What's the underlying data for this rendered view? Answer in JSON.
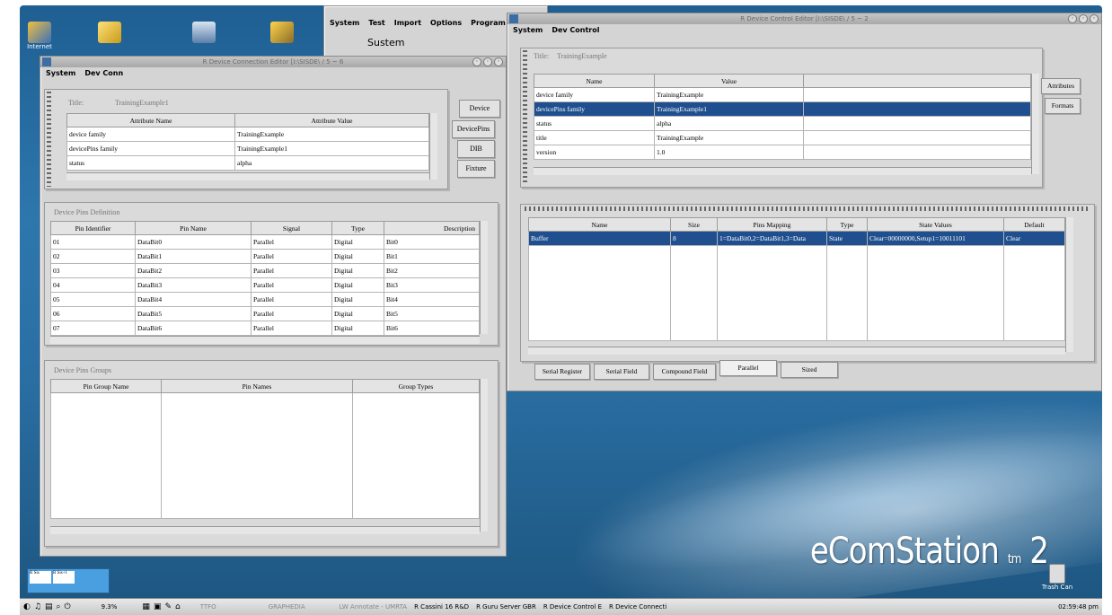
{
  "desktop": {
    "icons": [
      "Internet",
      "",
      "",
      ""
    ],
    "brand": "eComStation",
    "brand_tm": "tm",
    "brand_ver": "2",
    "trash_label": "Trash Can"
  },
  "back_window": {
    "menu": [
      "System",
      "Test",
      "Import",
      "Options",
      "Program"
    ],
    "heading": "Sustem"
  },
  "win_conn": {
    "title": "R Device Connection Editor [I:\\SISDE\\  / 5 ~ 6",
    "menu": [
      "System",
      "Dev Conn"
    ],
    "title_label": "Title:",
    "title_value": "TrainingExample1",
    "attr_headers": [
      "Attribute Name",
      "Attribute Value"
    ],
    "attr_rows": [
      [
        "device family",
        "TrainingExample"
      ],
      [
        "devicePins family",
        "TrainingExample1"
      ],
      [
        "status",
        "alpha"
      ]
    ],
    "side_tabs": [
      "Device",
      "DevicePins",
      "DIB",
      "Fixture"
    ],
    "pins_label": "Device Pins Definition",
    "pins_headers": [
      "Pin Identifier",
      "Pin Name",
      "Signal",
      "Type",
      "Description"
    ],
    "pins_rows": [
      [
        "01",
        "DataBit0",
        "Parallel",
        "Digital",
        "Bit0"
      ],
      [
        "02",
        "DataBit1",
        "Parallel",
        "Digital",
        "Bit1"
      ],
      [
        "03",
        "DataBit2",
        "Parallel",
        "Digital",
        "Bit2"
      ],
      [
        "04",
        "DataBit3",
        "Parallel",
        "Digital",
        "Bit3"
      ],
      [
        "05",
        "DataBit4",
        "Parallel",
        "Digital",
        "Bit4"
      ],
      [
        "06",
        "DataBit5",
        "Parallel",
        "Digital",
        "Bit5"
      ],
      [
        "07",
        "DataBit6",
        "Parallel",
        "Digital",
        "Bit6"
      ]
    ],
    "groups_label": "Device Pins Groups",
    "groups_headers": [
      "Pin Group Name",
      "Pin Names",
      "Group Types"
    ]
  },
  "win_ctrl": {
    "title": "R Device Control Editor [I:\\SISDE\\  / 5 ~ 2",
    "menu": [
      "System",
      "Dev Control"
    ],
    "title_label": "Title:",
    "title_value": "TrainingExample",
    "prop_headers": [
      "Name",
      "Value"
    ],
    "prop_rows": [
      [
        "device family",
        "TrainingExample"
      ],
      [
        "devicePins family",
        "TrainingExample1"
      ],
      [
        "status",
        "alpha"
      ],
      [
        "title",
        "TrainingExample"
      ],
      [
        "version",
        "1.0"
      ]
    ],
    "side_tabs": [
      "Attributes",
      "Formats"
    ],
    "reg_headers": [
      "Name",
      "Size",
      "Pins Mapping",
      "Type",
      "State Values",
      "Default"
    ],
    "reg_rows": [
      [
        "Buffer",
        "8",
        "1=DataBit0,2=DataBit1,3=Data",
        "State",
        "Clear=00000000,Setup1=10011101",
        "Clear"
      ]
    ],
    "bottom_tabs": [
      "Serial Register",
      "Serial Field",
      "Compound Field",
      "Parallel",
      "Sized"
    ]
  },
  "taskbar": {
    "zoom": "9.3%",
    "items": [
      "TTFO",
      "GRAPHEDIA",
      "LW Annotate - UMRTA",
      "R Cassini 16 R&D",
      "R Guru Server GBR",
      "R Device Control E",
      "R Device Connecti"
    ],
    "clock": "02:59:48 pm"
  },
  "pager": [
    "R Sis",
    "R Sis+1"
  ]
}
